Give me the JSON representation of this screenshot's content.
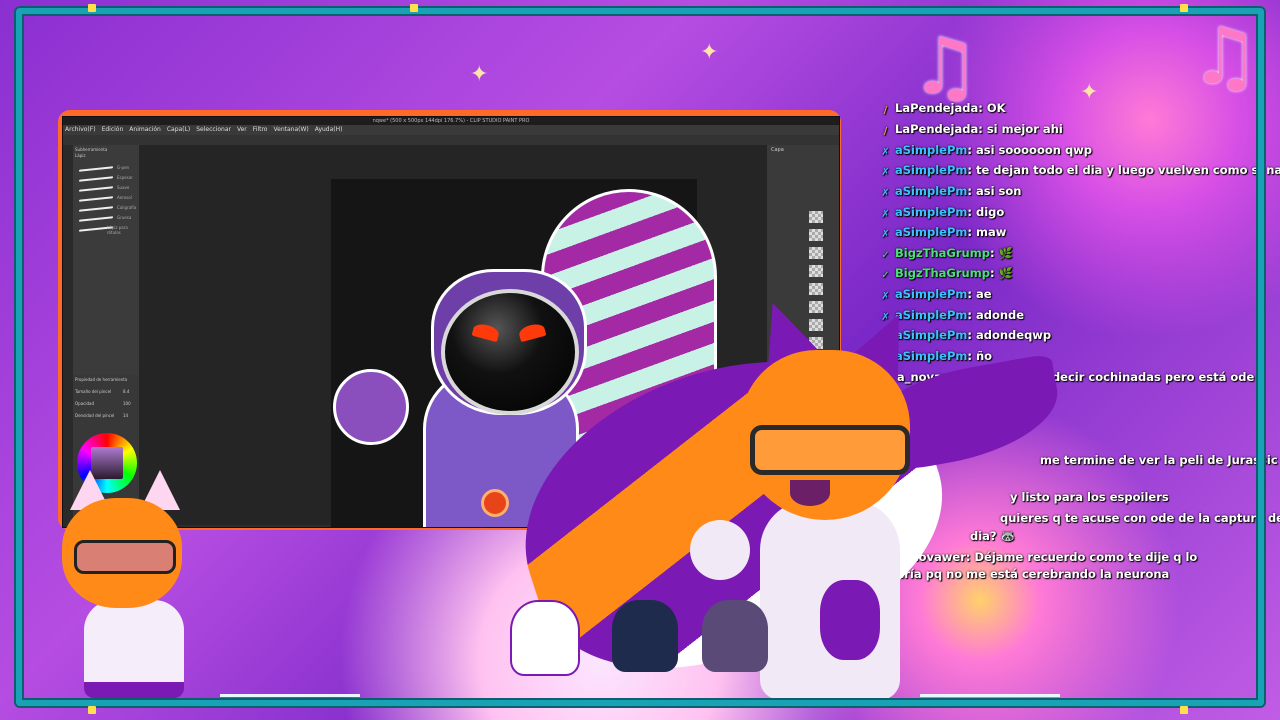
{
  "app": {
    "window_title": "nqwe* (500 x 500px 144dpi 176.7%) - CLIP STUDIO PAINT PRO",
    "menu": [
      "Archivo(F)",
      "Edición",
      "Animación",
      "Capa(L)",
      "Seleccionar",
      "Ver",
      "Filtro",
      "Ventana(W)",
      "Ayuda(H)"
    ],
    "brush_panel_title": "Subherramienta",
    "brush_tab": "Lápiz",
    "brushes": [
      "G-pen",
      "Espesor",
      "Suave",
      "Aerosol",
      "Caligrafía",
      "Gruesa",
      "Lápiz para rótulos"
    ],
    "props_title": "Propiedad de herramienta",
    "props": [
      "Tamaño del pincel",
      "Opacidad",
      "Densidad del pincel"
    ],
    "props_values": [
      "8.4",
      "100",
      "14"
    ],
    "layers_title": "Capa"
  },
  "chat": {
    "messages": [
      {
        "badge": "wand",
        "user": "LaPendejada",
        "text": ": OK"
      },
      {
        "badge": "wand",
        "user": "LaPendejada",
        "text": ": si mejor ahi"
      },
      {
        "badge": "x",
        "user": "aSimplePm",
        "text": ": asi soooooon qwp"
      },
      {
        "badge": "x",
        "user": "aSimplePm",
        "text": ": te dejan todo el dia y luego vuelven como si nada"
      },
      {
        "badge": "x",
        "user": "aSimplePm",
        "text": ": asi son"
      },
      {
        "badge": "x",
        "user": "aSimplePm",
        "text": ": digo"
      },
      {
        "badge": "x",
        "user": "aSimplePm",
        "text": ": maw"
      },
      {
        "badge": "chk",
        "user": "BigzThaGrump",
        "text": ": 🌿"
      },
      {
        "badge": "chk",
        "user": "BigzThaGrump",
        "text": ": 🌿"
      },
      {
        "badge": "x",
        "user": "aSimplePm",
        "text": ": ae"
      },
      {
        "badge": "x",
        "user": "aSimplePm",
        "text": ": adonde"
      },
      {
        "badge": "x",
        "user": "aSimplePm",
        "text": ": adondeqwp"
      },
      {
        "badge": "x",
        "user": "aSimplePm",
        "text": ": ño"
      },
      {
        "badge": "",
        "user": "vita_novawer",
        "text": ": Ijole quería decir cochinadas pero está ode"
      },
      {
        "badge": "",
        "user": "",
        "text": "me termine de ver la peli de Jurassic"
      },
      {
        "badge": "",
        "user": "",
        "text": "y listo para los espoilers"
      },
      {
        "badge": "",
        "user": "",
        "text": "quieres q te acuse con ode de la captura de"
      },
      {
        "badge": "",
        "user": "",
        "text": "dia? 🦝"
      },
      {
        "badge": "",
        "user": "vita_novawer",
        "text": ": Déjame recuerdo como te dije q lo quería pq no me está cerebrando la neurona"
      }
    ]
  },
  "colors": {
    "frame": "#19a2b6",
    "username_blue": "#3ec0ff",
    "username_green": "#49e27a",
    "monitor": "#ff6a2a"
  },
  "icons": {
    "badge_x": "✗",
    "badge_chk": "✓",
    "badge_wand": "/",
    "note": "♫",
    "spark": "✦"
  }
}
